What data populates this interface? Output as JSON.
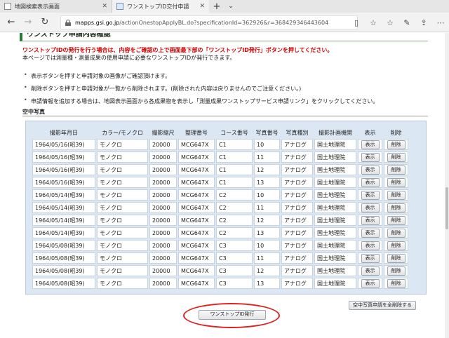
{
  "browser": {
    "tabs": [
      {
        "title": "地図検索表示画面",
        "active": false
      },
      {
        "title": "ワンストップID交付申請",
        "active": true
      }
    ],
    "new_tab": "+",
    "url": {
      "host": "mapps.gsi.go.jp",
      "path": "/actionOnestopApplyBL.do?specificationId=362926&r=368429346443604"
    }
  },
  "page": {
    "heading": "ワンストップ申請内容確認",
    "warning": "ワンストップIDの発行を行う場合は、内容をご確認の上で画面最下部の「ワンストップID発行」ボタンを押してください。",
    "intro": "本ページでは測量種・測量成果の使用申請に必要なワンストップIDが発行できます。",
    "notes": [
      "表示ボタンを押すと申請対象の画像がご確認頂けます。",
      "削除ボタンを押すと申請対象が一覧から削除されます。(削除された内容は戻りませんのでご注意ください。)",
      "申請情報を追加する場合は、地図表示画面から各成果物を表示し「測量成果ワンストップサービス申請リンク」をクリックしてください。"
    ],
    "subsection": "空中写真",
    "table": {
      "headers": [
        "撮影年月日",
        "カラー/モノクロ",
        "撮影縮尺",
        "整理番号",
        "コース番号",
        "写真番号",
        "写真種別",
        "撮影計画機関",
        "表示",
        "削除"
      ],
      "rows": [
        [
          "1964/05/16(昭39)",
          "モノクロ",
          "20000",
          "MCG647X",
          "C1",
          "10",
          "アナログ",
          "国土地理院"
        ],
        [
          "1964/05/16(昭39)",
          "モノクロ",
          "20000",
          "MCG647X",
          "C1",
          "11",
          "アナログ",
          "国土地理院"
        ],
        [
          "1964/05/16(昭39)",
          "モノクロ",
          "20000",
          "MCG647X",
          "C1",
          "12",
          "アナログ",
          "国土地理院"
        ],
        [
          "1964/05/16(昭39)",
          "モノクロ",
          "20000",
          "MCG647X",
          "C1",
          "13",
          "アナログ",
          "国土地理院"
        ],
        [
          "1964/05/14(昭39)",
          "モノクロ",
          "20000",
          "MCG647X",
          "C2",
          "10",
          "アナログ",
          "国土地理院"
        ],
        [
          "1964/05/14(昭39)",
          "モノクロ",
          "20000",
          "MCG647X",
          "C2",
          "11",
          "アナログ",
          "国土地理院"
        ],
        [
          "1964/05/14(昭39)",
          "モノクロ",
          "20000",
          "MCG647X",
          "C2",
          "12",
          "アナログ",
          "国土地理院"
        ],
        [
          "1964/05/14(昭39)",
          "モノクロ",
          "20000",
          "MCG647X",
          "C2",
          "13",
          "アナログ",
          "国土地理院"
        ],
        [
          "1964/05/08(昭39)",
          "モノクロ",
          "20000",
          "MCG647X",
          "C3",
          "10",
          "アナログ",
          "国土地理院"
        ],
        [
          "1964/05/08(昭39)",
          "モノクロ",
          "20000",
          "MCG647X",
          "C3",
          "11",
          "アナログ",
          "国土地理院"
        ],
        [
          "1964/05/08(昭39)",
          "モノクロ",
          "20000",
          "MCG647X",
          "C3",
          "12",
          "アナログ",
          "国土地理院"
        ],
        [
          "1964/05/08(昭39)",
          "モノクロ",
          "20000",
          "MCG647X",
          "C3",
          "13",
          "アナログ",
          "国土地理院"
        ]
      ],
      "show_label": "表示",
      "delete_label": "削除"
    },
    "bulk_delete_label": "空中写真申請を全削除する",
    "issue_label": "ワンストップID発行"
  },
  "colors": {
    "warning": "#d40000",
    "heading_accent": "#2a7a3a",
    "table_bg": "#dbe7f3",
    "highlight": "#e02020"
  }
}
